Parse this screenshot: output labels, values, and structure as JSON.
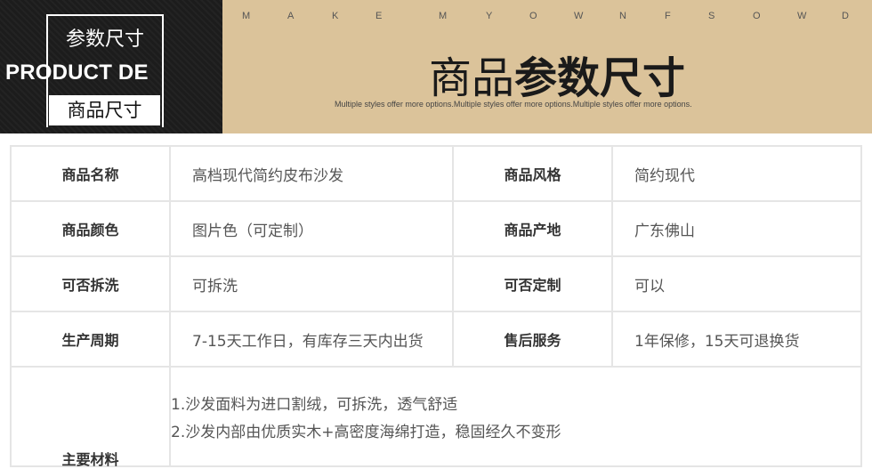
{
  "banner": {
    "box_title": "参数尺寸",
    "en_title": "PRODUCT DE",
    "box_subtitle": "商品尺寸",
    "letters": [
      "M",
      "A",
      "K",
      "E",
      "M",
      "Y",
      "O",
      "W",
      "N",
      "F",
      "S",
      "O",
      "W",
      "D"
    ],
    "title_light": "商品",
    "title_bold": "参数尺寸",
    "subtitle": "Multiple styles offer more options.Multiple styles offer more options.Multiple styles offer more options."
  },
  "specs": [
    {
      "label1": "商品名称",
      "value1": "高档现代简约皮布沙发",
      "label2": "商品风格",
      "value2": "简约现代"
    },
    {
      "label1": "商品颜色",
      "value1": "图片色（可定制）",
      "label2": "商品产地",
      "value2": "广东佛山"
    },
    {
      "label1": "可否拆洗",
      "value1": "可拆洗",
      "label2": "可否定制",
      "value2": "可以"
    },
    {
      "label1": "生产周期",
      "value1": "7-15天工作日，有库存三天内出货",
      "label2": "售后服务",
      "value2": "1年保修，15天可退换货"
    }
  ],
  "materials": {
    "label": "主要材料",
    "lines": [
      "1.沙发面料为进口割绒，可拆洗，透气舒适",
      "2.沙发内部由优质实木+高密度海绵打造，稳固经久不变形"
    ]
  },
  "colors": {
    "dark_panel": "#1c1c1c",
    "gold_panel": "#dbc39a",
    "border": "#e5e5e5"
  }
}
